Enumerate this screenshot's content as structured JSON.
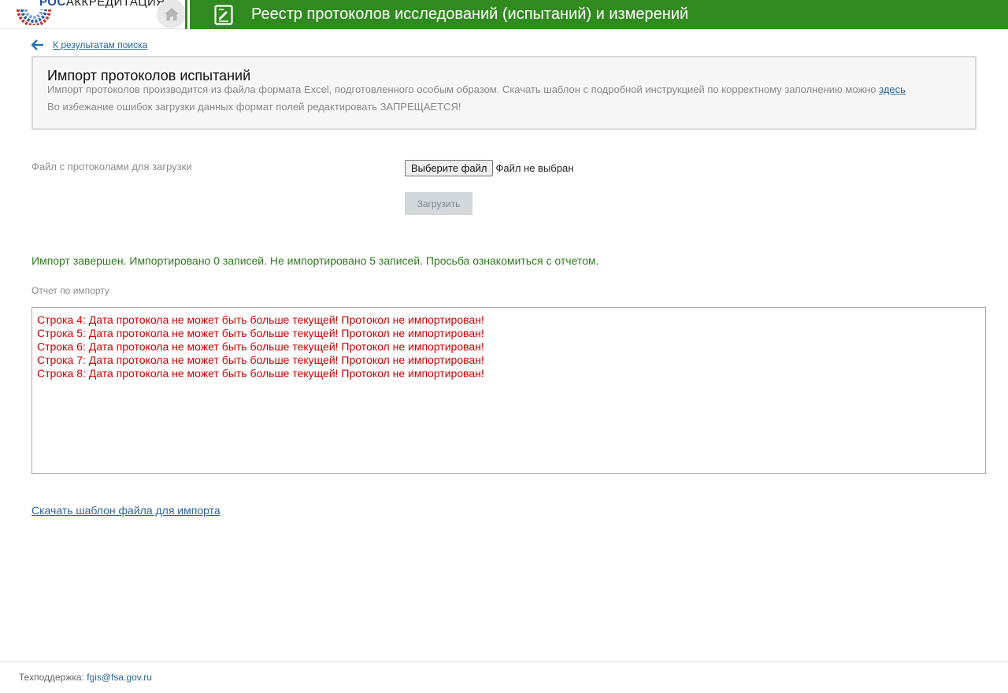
{
  "header": {
    "logo_prefix": "РОС",
    "logo_suffix": "АККРЕДИТАЦИЯ",
    "title": "Реестр протоколов исследований (испытаний) и измерений",
    "bar_color": "#318a1f"
  },
  "nav": {
    "back_label": "К результатам поиска"
  },
  "info": {
    "title": "Импорт протоколов испытаний",
    "line1": "Импорт протоколов производится из файла формата Excel, подготовленного особым образом. Скачать шаблон с подробной инструкцией по корректному заполнению можно",
    "line1_link": "здесь",
    "line2": "Во избежание ошибок загрузки данных формат полей редактировать ЗАПРЕЩАЕТСЯ!"
  },
  "form": {
    "file_label": "Файл с протоколами для загрузки",
    "choose_button": "Выберите файл",
    "file_status": "Файл не выбран",
    "upload_button": "Загрузить"
  },
  "result": {
    "message": "Импорт завершен. Импортировано 0 записей. Не импортировано 5 записей. Просьба ознакомиться с отчетом.",
    "report_label": "Отчет по импорту",
    "report_lines": [
      "Строка 4: Дата протокола не может быть больше текущей! Протокол не импортирован!",
      "Строка 5: Дата протокола не может быть больше текущей! Протокол не импортирован!",
      "Строка 6: Дата протокола не может быть больше текущей! Протокол не импортирован!",
      "Строка 7: Дата протокола не может быть больше текущей! Протокол не импортирован!",
      "Строка 8: Дата протокола не может быть больше текущей! Протокол не импортирован!"
    ]
  },
  "template_link": "Скачать шаблон файла для импорта",
  "footer": {
    "label": "Техподдержка:",
    "email": "fgis@fsa.gov.ru"
  },
  "icons": {
    "home": "home-icon",
    "document": "document-edit-icon",
    "back": "arrow-left-icon"
  }
}
